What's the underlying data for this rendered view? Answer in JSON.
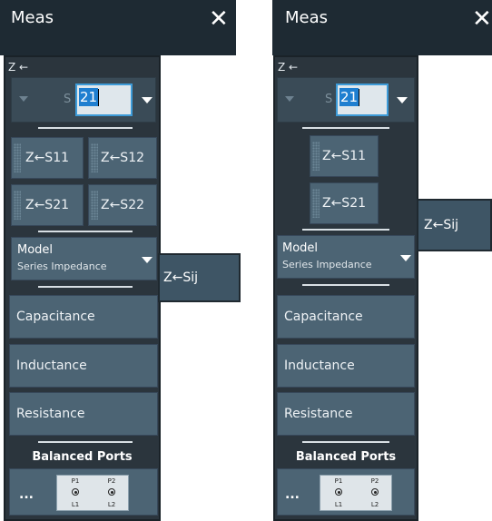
{
  "panels": [
    {
      "title": "Meas",
      "parameter_label": "Z ←",
      "s_prefix": "S",
      "index_value": "21",
      "buttons": [
        "Z←S11",
        "Z←S12",
        "Z←S21",
        "Z←S22"
      ],
      "model_label": "Model",
      "model_value": "Series Impedance",
      "components": [
        "Capacitance",
        "Inductance",
        "Resistance"
      ],
      "balanced_ports_label": "Balanced Ports",
      "ellipsis": "...",
      "ports": [
        {
          "top": "P1",
          "bottom": "L1"
        },
        {
          "top": "P2",
          "bottom": "L2"
        }
      ],
      "popup_label": "Z←Sij"
    },
    {
      "title": "Meas",
      "parameter_label": "Z ←",
      "s_prefix": "S",
      "index_value": "21",
      "buttons": [
        "Z←S11",
        "Z←S21"
      ],
      "model_label": "Model",
      "model_value": "Series Impedance",
      "components": [
        "Capacitance",
        "Inductance",
        "Resistance"
      ],
      "balanced_ports_label": "Balanced Ports",
      "ellipsis": "...",
      "ports": [
        {
          "top": "P1",
          "bottom": "L1"
        },
        {
          "top": "P2",
          "bottom": "L2"
        }
      ],
      "popup_label": "Z←Sij"
    }
  ],
  "icons": {
    "close": "close-icon",
    "dropdown": "chevron-down-icon",
    "port": "port-connector-icon"
  },
  "colors": {
    "titlebar": "#1e2a33",
    "panel": "#2b353d",
    "button": "#4c6474",
    "selection": "#1f7fd0",
    "focus_border": "#3d9bd8"
  }
}
